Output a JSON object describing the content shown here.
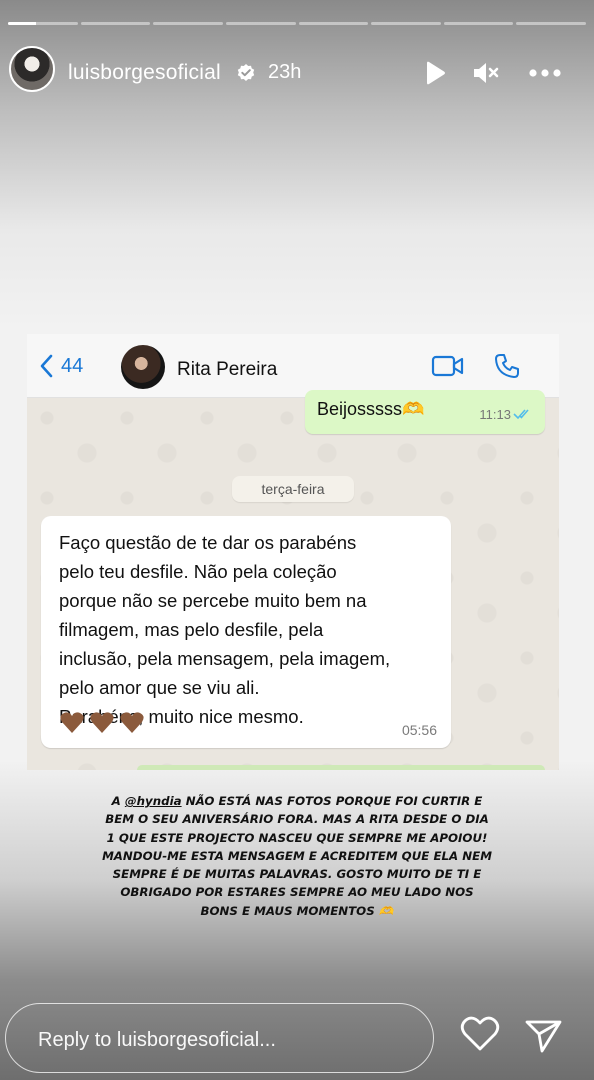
{
  "story": {
    "segments": [
      {
        "fill_fraction": 0.4
      },
      {
        "fill_fraction": 0
      },
      {
        "fill_fraction": 0
      },
      {
        "fill_fraction": 0
      },
      {
        "fill_fraction": 0
      },
      {
        "fill_fraction": 0
      },
      {
        "fill_fraction": 0
      },
      {
        "fill_fraction": 0
      }
    ]
  },
  "header": {
    "username": "luisborgesoficial",
    "time_ago": "23h",
    "icons": [
      "play-icon",
      "mute-icon",
      "more-icon"
    ]
  },
  "chat": {
    "back_count": "44",
    "contact_name": "Rita Pereira",
    "outgoing": {
      "text": "Beijosssss",
      "emoji": "🫶",
      "time": "11:13"
    },
    "day_label": "terça-feira",
    "incoming": {
      "text": "Faço questão de te dar os parabéns\npelo teu desfile. Não pela coleção\nporque não se percebe muito bem na\nfilmagem, mas pelo desfile, pela\ninclusão, pela mensagem, pela imagem,\npelo amor que se viu ali.\nParabéns, muito nice mesmo.",
      "hearts": "🤎🤎🤎",
      "time": "05:56"
    }
  },
  "caption": {
    "prefix": "A ",
    "mention": "@hyndia",
    "rest": " NÃO ESTÁ NAS FOTOS PORQUE FOI CURTIR E BEM O SEU ANIVERSÁRIO FORA. MAS A RITA DESDE O DIA 1 QUE ESTE PROJECTO NASCEU QUE SEMPRE ME APOIOU! MANDOU-ME ESTA MENSAGEM E ACREDITEM QUE ELA NEM SEMPRE É DE MUITAS PALAVRAS. GOSTO MUITO DE TI E OBRIGADO POR ESTARES SEMPRE AO MEU LADO NOS BONS E MAUS MOMENTOS 🫶"
  },
  "reply": {
    "placeholder": "Reply to luisborgesoficial..."
  },
  "colors": {
    "whatsapp_blue": "#1a78d6",
    "outgoing_bubble": "#dcf8c6",
    "read_ticks": "#53bdeb",
    "heart_brown": "#8b5a3c"
  }
}
